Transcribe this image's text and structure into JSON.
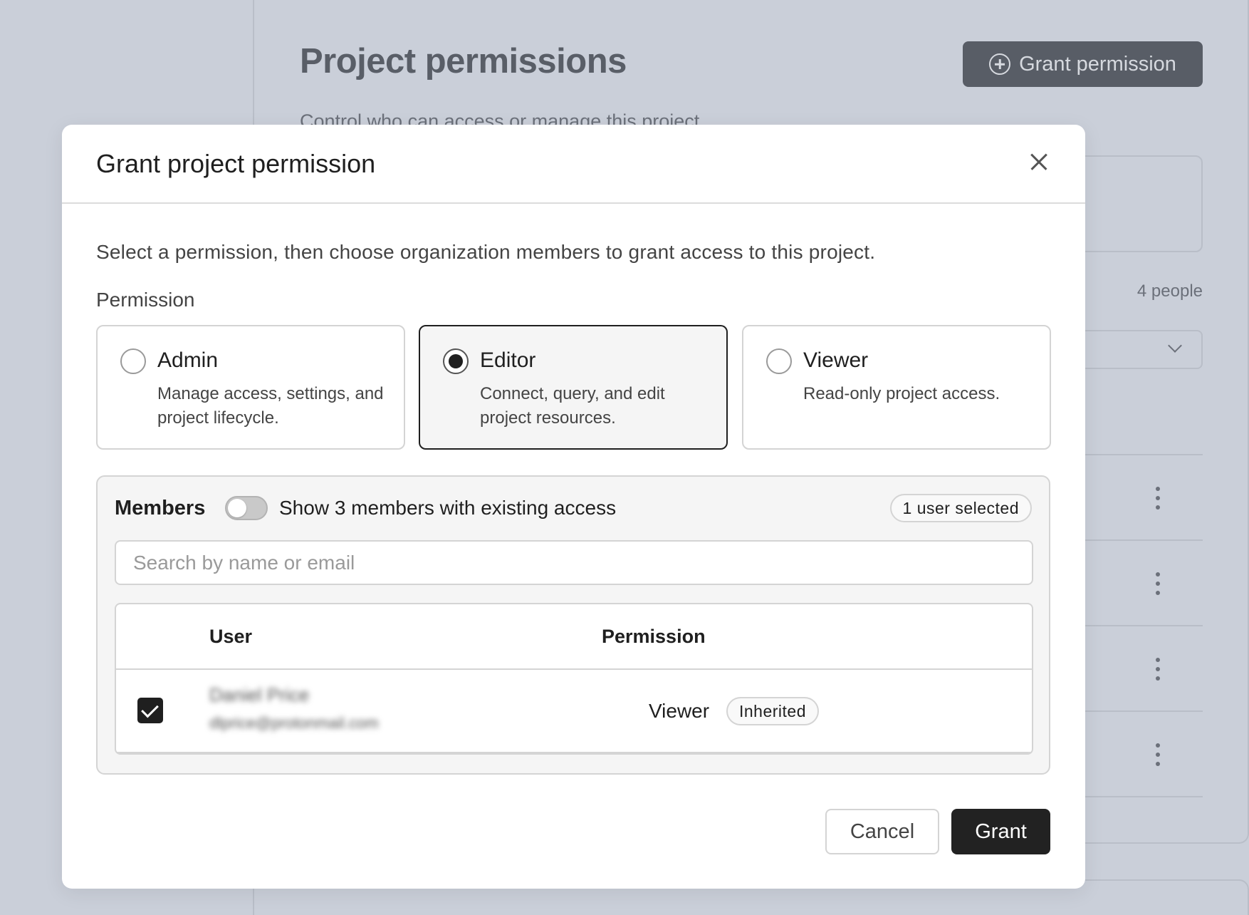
{
  "background": {
    "page_title": "Project permissions",
    "page_subtitle": "Control who can access or manage this project",
    "grant_button_label": "Grant permission",
    "people_count": "4 people"
  },
  "modal": {
    "title": "Grant project permission",
    "description": "Select a permission, then choose organization members to grant access to this project.",
    "permission_label": "Permission",
    "permission_options": [
      {
        "name": "Admin",
        "description": "Manage access, settings, and project lifecycle.",
        "selected": false
      },
      {
        "name": "Editor",
        "description": "Connect, query, and edit project resources.",
        "selected": true
      },
      {
        "name": "Viewer",
        "description": "Read-only project access.",
        "selected": false
      }
    ],
    "members": {
      "title": "Members",
      "toggle_label": "Show 3 members with existing access",
      "toggle_on": false,
      "selected_badge": "1 user selected",
      "search_placeholder": "Search by name or email",
      "search_value": "",
      "columns": [
        "User",
        "Permission"
      ],
      "rows": [
        {
          "checked": true,
          "name": "Daniel Price",
          "email": "dlprice@protonmail.com",
          "permission": "Viewer",
          "badge": "Inherited"
        }
      ]
    },
    "cancel_label": "Cancel",
    "grant_label": "Grant"
  },
  "colors": {
    "backdrop": "#cacfd9",
    "primary_button": "#222222",
    "selected_border": "#1f1f1f"
  }
}
